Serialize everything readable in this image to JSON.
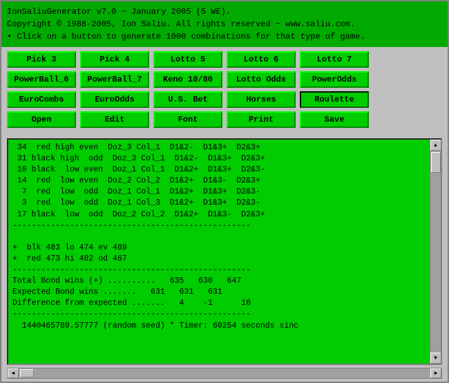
{
  "header": {
    "line1": "IonSaliuGenerator v7.0 ~ January 2005 (5 WE).",
    "line2": "Copyright © 1988-2005, Ion Saliu. All rights reserved ~ www.saliu.com.",
    "line3": "• Click on a button to generate 1000 combinations for that type of game."
  },
  "rows": [
    {
      "row": [
        {
          "label": "Pick 3"
        },
        {
          "label": "Pick 4"
        },
        {
          "label": "Lotto 5"
        },
        {
          "label": "Lotto 6"
        },
        {
          "label": "Lotto 7"
        }
      ]
    },
    {
      "row": [
        {
          "label": "PowerBall_6"
        },
        {
          "label": "PowerBall_7"
        },
        {
          "label": "Keno 10/80"
        },
        {
          "label": "Lotto Odds"
        },
        {
          "label": "PowerOdds"
        }
      ]
    },
    {
      "row": [
        {
          "label": "EuroCombs"
        },
        {
          "label": "EuroOdds"
        },
        {
          "label": "U.S. Bet"
        },
        {
          "label": "Horses"
        },
        {
          "label": "Roulette"
        }
      ]
    },
    {
      "row": [
        {
          "label": "Open"
        },
        {
          "label": "Edit"
        },
        {
          "label": "Font"
        },
        {
          "label": "Print"
        },
        {
          "label": "Save"
        }
      ]
    }
  ],
  "output": {
    "text": " 34  red high even  Doz_3 Col_1  D1&2-  D1&3+  D2&3+\n 31 black high  odd  Doz_3 Col_1  D1&2-  D1&3+  D2&3+\n 10 black  low even  Doz_1 Col_1  D1&2+  D1&3+  D2&3-\n 14  red  low even  Doz_2 Col_2  D1&2+  D1&3-  D2&3+\n  7  red  low  odd  Doz_1 Col_1  D1&2+  D1&3+  D2&3-\n  3  red  low  odd  Doz_1 Col_3  D1&2+  D1&3+  D2&3-\n 17 black  low  odd  Doz_2 Col_2  D1&2+  D1&3-  D2&3+\n--------------------------------------------------\n\n+  blk 483 lo 474 ev 489\n+  red 473 hi 482 od 467\n--------------------------------------------------\nTotal Bond wins (+) ..........   635   630   647\nExpected Bond wins .......   631   631   631\nDifference from expected .......   4    -1      16\n--------------------------------------------------\n  1440465789.57777 (random seed) * Timer: 60254 seconds sinc"
  },
  "scrollbar": {
    "up_arrow": "▲",
    "down_arrow": "▼",
    "left_arrow": "◄",
    "right_arrow": "►"
  }
}
